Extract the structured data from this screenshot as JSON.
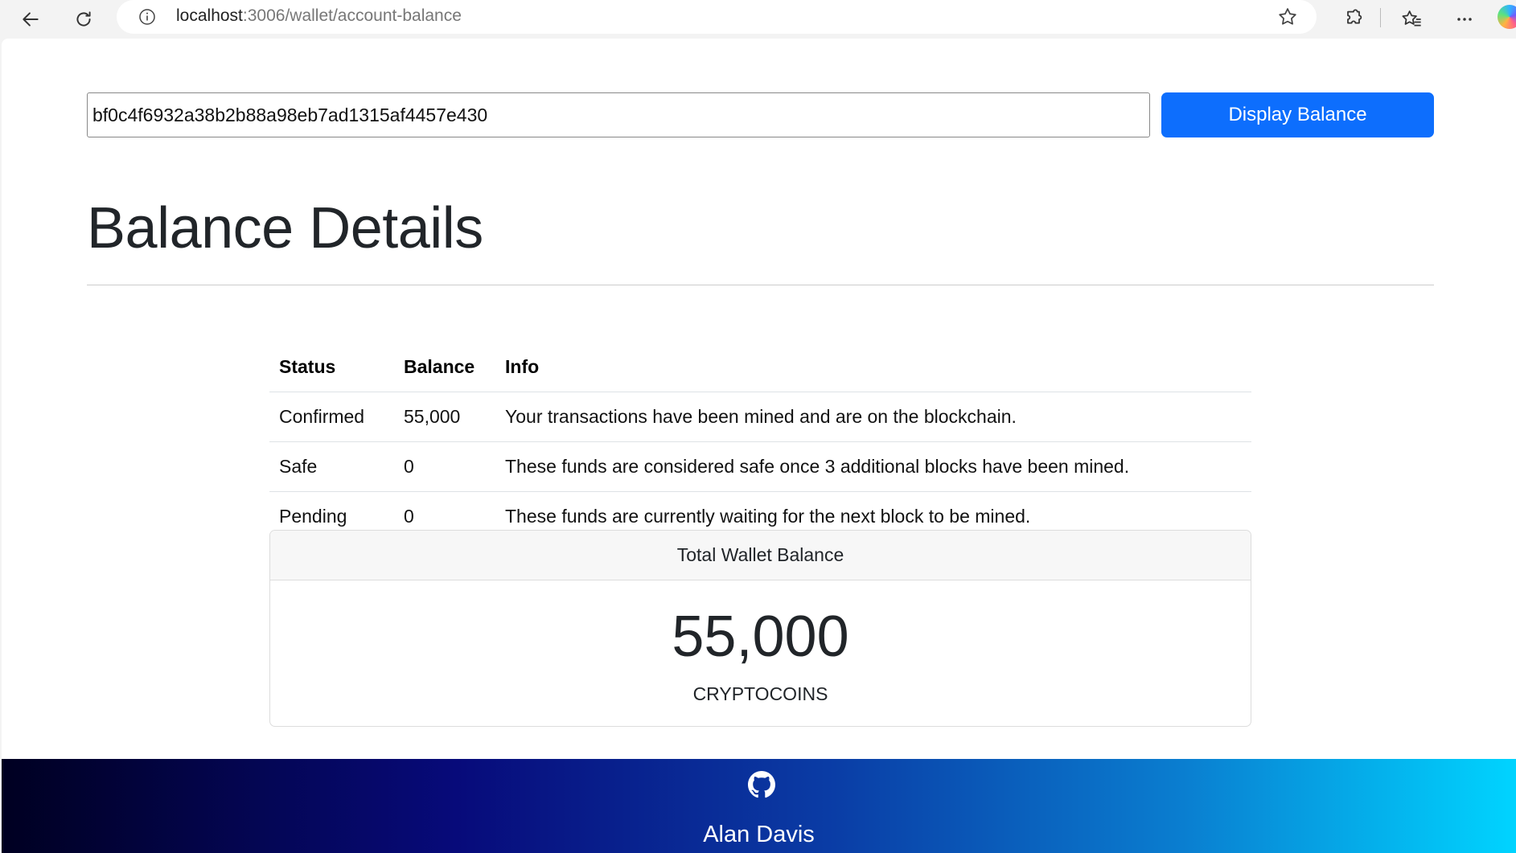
{
  "browser": {
    "url_host": "localhost",
    "url_rest": ":3006/wallet/account-balance"
  },
  "address_form": {
    "value": "bf0c4f6932a38b2b88a98eb7ad1315af4457e430",
    "button_label": "Display Balance"
  },
  "page": {
    "title": "Balance Details"
  },
  "balance_table": {
    "headers": [
      "Status",
      "Balance",
      "Info"
    ],
    "rows": [
      {
        "status": "Confirmed",
        "balance": "55,000",
        "info": "Your transactions have been mined and are on the blockchain."
      },
      {
        "status": "Safe",
        "balance": "0",
        "info": "These funds are considered safe once 3 additional blocks have been mined."
      },
      {
        "status": "Pending",
        "balance": "0",
        "info": "These funds are currently waiting for the next block to be mined."
      }
    ]
  },
  "total": {
    "header": "Total Wallet Balance",
    "amount": "55,000",
    "unit": "CRYPTOCOINS"
  },
  "footer": {
    "icon": "github-icon",
    "author": "Alan Davis"
  },
  "colors": {
    "primary": "#0d6efd"
  }
}
